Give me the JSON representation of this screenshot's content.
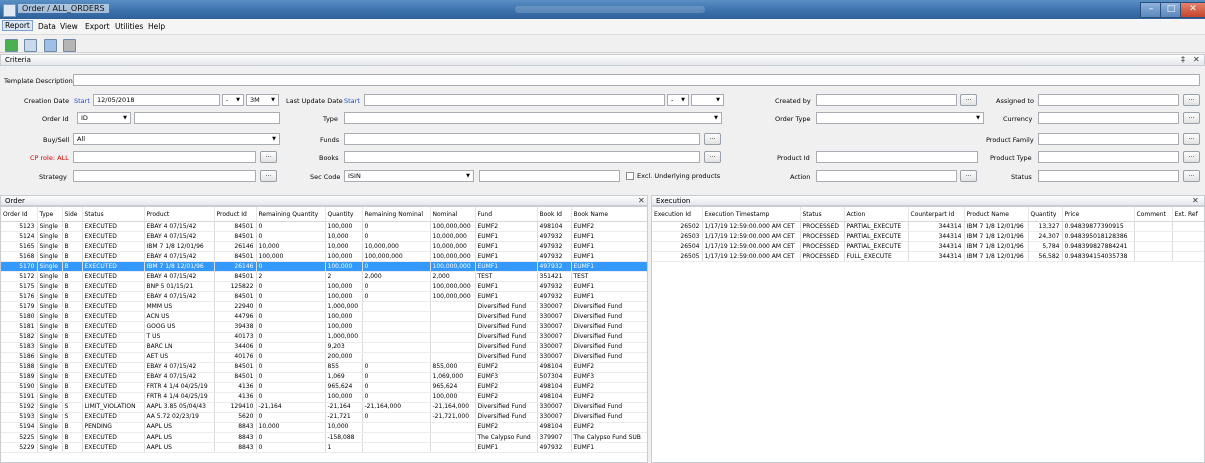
{
  "window": {
    "title": "Order / ALL_ORDERS"
  },
  "menu": [
    "Report",
    "Data",
    "View",
    "Export",
    "Utilities",
    "Help"
  ],
  "criteria": {
    "title": "Criteria",
    "template_description_label": "Template Description",
    "creation_date_label": "Creation Date",
    "start_label": "Start",
    "creation_date_value": "12/05/2018",
    "range_value": "3M",
    "last_update_label": "Last Update Date",
    "created_by_label": "Created by",
    "assigned_to_label": "Assigned to",
    "order_id_label": "Order Id",
    "order_id_type": "ID",
    "type_label": "Type",
    "order_type_label": "Order Type",
    "currency_label": "Currency",
    "buysell_label": "Buy/Sell",
    "buysell_value": "All",
    "funds_label": "Funds",
    "product_family_label": "Product Family",
    "cp_role_label": "CP role: ALL",
    "books_label": "Books",
    "product_id_label": "Product Id",
    "product_type_label": "Product Type",
    "strategy_label": "Strategy",
    "sec_code_label": "Sec Code",
    "sec_code_value": "ISIN",
    "excl_label": "Excl. Underlying products",
    "action_label": "Action",
    "status_label": "Status",
    "ellipsis": "..."
  },
  "order": {
    "title": "Order",
    "columns": [
      "Order Id",
      "Type",
      "Side",
      "Status",
      "Product",
      "Product Id",
      "Remaining Quantity",
      "Quantity",
      "Remaining Nominal",
      "Nominal",
      "Fund",
      "Book Id",
      "Book Name"
    ],
    "rows": [
      [
        "5123",
        "Single",
        "B",
        "EXECUTED",
        "EBAY 4 07/15/42",
        "84501",
        "0",
        "100,000",
        "0",
        "100,000,000",
        "EUMF2",
        "498104",
        "EUMF2"
      ],
      [
        "5124",
        "Single",
        "B",
        "EXECUTED",
        "EBAY 4 07/15/42",
        "84501",
        "0",
        "10,000",
        "0",
        "10,000,000",
        "EUMF1",
        "497932",
        "EUMF1"
      ],
      [
        "5165",
        "Single",
        "B",
        "EXECUTED",
        "IBM 7 1/8 12/01/96",
        "26146",
        "10,000",
        "10,000",
        "10,000,000",
        "10,000,000",
        "EUMF1",
        "497932",
        "EUMF1"
      ],
      [
        "5168",
        "Single",
        "B",
        "EXECUTED",
        "EBAY 4 07/15/42",
        "84501",
        "100,000",
        "100,000",
        "100,000,000",
        "100,000,000",
        "EUMF1",
        "497932",
        "EUMF1"
      ],
      [
        "5170",
        "Single",
        "B",
        "EXECUTED",
        "IBM 7 1/8 12/01/96",
        "26146",
        "0",
        "100,000",
        "0",
        "100,000,000",
        "EUMF1",
        "497932",
        "EUMF1"
      ],
      [
        "5172",
        "Single",
        "B",
        "EXECUTED",
        "EBAY 4 07/15/42",
        "84501",
        "2",
        "2",
        "2,000",
        "2,000",
        "TEST",
        "351421",
        "TEST"
      ],
      [
        "5175",
        "Single",
        "B",
        "EXECUTED",
        "BNP 5 01/15/21",
        "125822",
        "0",
        "100,000",
        "0",
        "100,000,000",
        "EUMF1",
        "497932",
        "EUMF1"
      ],
      [
        "5176",
        "Single",
        "B",
        "EXECUTED",
        "EBAY 4 07/15/42",
        "84501",
        "0",
        "100,000",
        "0",
        "100,000,000",
        "EUMF1",
        "497932",
        "EUMF1"
      ],
      [
        "5179",
        "Single",
        "B",
        "EXECUTED",
        "MMM US",
        "22940",
        "0",
        "1,000,000",
        "",
        "",
        "Diversified Fund",
        "330007",
        "Diversified Fund"
      ],
      [
        "5180",
        "Single",
        "B",
        "EXECUTED",
        "ACN US",
        "44796",
        "0",
        "100,000",
        "",
        "",
        "Diversified Fund",
        "330007",
        "Diversified Fund"
      ],
      [
        "5181",
        "Single",
        "B",
        "EXECUTED",
        "GOOG US",
        "39438",
        "0",
        "100,000",
        "",
        "",
        "Diversified Fund",
        "330007",
        "Diversified Fund"
      ],
      [
        "5182",
        "Single",
        "B",
        "EXECUTED",
        "T US",
        "40173",
        "0",
        "1,000,000",
        "",
        "",
        "Diversified Fund",
        "330007",
        "Diversified Fund"
      ],
      [
        "5183",
        "Single",
        "B",
        "EXECUTED",
        "BARC LN",
        "34406",
        "0",
        "9,203",
        "",
        "",
        "Diversified Fund",
        "330007",
        "Diversified Fund"
      ],
      [
        "5186",
        "Single",
        "B",
        "EXECUTED",
        "AET US",
        "40176",
        "0",
        "200,000",
        "",
        "",
        "Diversified Fund",
        "330007",
        "Diversified Fund"
      ],
      [
        "5188",
        "Single",
        "B",
        "EXECUTED",
        "EBAY 4 07/15/42",
        "84501",
        "0",
        "855",
        "0",
        "855,000",
        "EUMF2",
        "498104",
        "EUMF2"
      ],
      [
        "5189",
        "Single",
        "B",
        "EXECUTED",
        "EBAY 4 07/15/42",
        "84501",
        "0",
        "1,069",
        "0",
        "1,069,000",
        "EUMF3",
        "507304",
        "EUMF3"
      ],
      [
        "5190",
        "Single",
        "B",
        "EXECUTED",
        "FRTR 4 1/4 04/25/19",
        "4136",
        "0",
        "965,624",
        "0",
        "965,624",
        "EUMF2",
        "498104",
        "EUMF2"
      ],
      [
        "5191",
        "Single",
        "B",
        "EXECUTED",
        "FRTR 4 1/4 04/25/19",
        "4136",
        "0",
        "100,000",
        "0",
        "100,000",
        "EUMF2",
        "498104",
        "EUMF2"
      ],
      [
        "5192",
        "Single",
        "S",
        "LIMIT_VIOLATION",
        "AAPL 3.85 05/04/43",
        "129410",
        "-21,164",
        "-21,164",
        "-21,164,000",
        "-21,164,000",
        "Diversified Fund",
        "330007",
        "Diversified Fund"
      ],
      [
        "5193",
        "Single",
        "S",
        "EXECUTED",
        "AA 5.72 02/23/19",
        "5620",
        "0",
        "-21,721",
        "0",
        "-21,721,000",
        "Diversified Fund",
        "330007",
        "Diversified Fund"
      ],
      [
        "5194",
        "Single",
        "B",
        "PENDING",
        "AAPL US",
        "8843",
        "10,000",
        "10,000",
        "",
        "",
        "EUMF2",
        "498104",
        "EUMF2"
      ],
      [
        "5225",
        "Single",
        "B",
        "EXECUTED",
        "AAPL US",
        "8843",
        "0",
        "-158,088",
        "",
        "",
        "The Calypso Fund",
        "379907",
        "The Calypso Fund SUB"
      ],
      [
        "5229",
        "Single",
        "B",
        "EXECUTED",
        "AAPL US",
        "8843",
        "0",
        "1",
        "",
        "",
        "EUMF1",
        "497932",
        "EUMF1"
      ]
    ]
  },
  "execution": {
    "title": "Execution",
    "columns": [
      "Execution Id",
      "Execution Timestamp",
      "Status",
      "Action",
      "Counterpart Id",
      "Product Name",
      "Quantity",
      "Price",
      "Comment",
      "Ext. Ref"
    ],
    "rows": [
      [
        "26502",
        "1/17/19 12:59:00.000 AM CET",
        "PROCESSED",
        "PARTIAL_EXECUTE",
        "344314",
        "IBM 7 1/8 12/01/96",
        "13,327",
        "0.94839877390915",
        "",
        ""
      ],
      [
        "26503",
        "1/17/19 12:59:00.000 AM CET",
        "PROCESSED",
        "PARTIAL_EXECUTE",
        "344314",
        "IBM 7 1/8 12/01/96",
        "24,307",
        "0.948395018128386",
        "",
        ""
      ],
      [
        "26504",
        "1/17/19 12:59:00.000 AM CET",
        "PROCESSED",
        "PARTIAL_EXECUTE",
        "344314",
        "IBM 7 1/8 12/01/96",
        "5,784",
        "0.948399827884241",
        "",
        ""
      ],
      [
        "26505",
        "1/17/19 12:59:00.000 AM CET",
        "PROCESSED",
        "FULL_EXECUTE",
        "344314",
        "IBM 7 1/8 12/01/96",
        "56,582",
        "0.948394154035738",
        "",
        ""
      ]
    ]
  },
  "selected_order_row": 4,
  "icons": [
    "app-icon",
    "report-green-icon",
    "report-new-icon",
    "copy-icon",
    "print-icon",
    "pin-icon",
    "close-icon"
  ]
}
